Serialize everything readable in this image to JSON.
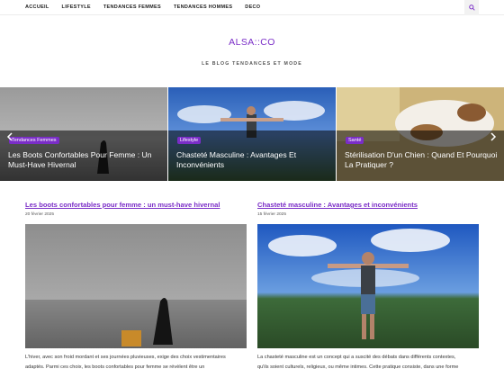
{
  "nav": {
    "items": [
      "ACCUEIL",
      "LIFESTYLE",
      "TENDANCES FEMMES",
      "TENDANCES HOMMES",
      "DECO"
    ],
    "search_icon": "search-icon"
  },
  "header": {
    "title": "ALSA::CO",
    "tagline": "LE BLOG TENDANCES ET MODE"
  },
  "slider": {
    "slides": [
      {
        "category": "Tendances Femmes",
        "title": "Les Boots Confortables Pour Femme : Un Must-Have Hivernal"
      },
      {
        "category": "Lifestyle",
        "title": "Chasteté Masculine : Avantages Et Inconvénients"
      },
      {
        "category": "Santé",
        "title": "Stérilisation D'un Chien : Quand Et Pourquoi La Pratiquer ?"
      }
    ],
    "prev_icon": "chevron-left-icon",
    "next_icon": "chevron-right-icon"
  },
  "articles": [
    {
      "title": "Les boots confortables pour femme : un must-have hivernal",
      "date": "20 février 2025",
      "excerpt_line1": "L'hiver, avec son froid mordant et ses journées pluvieuses, exige des choix vestimentaires",
      "excerpt_line2": "adaptés. Parmi ces choix, les boots confortables pour femme se révèlent être un"
    },
    {
      "title": "Chasteté masculine : Avantages et inconvénients",
      "date": "15 février 2025",
      "excerpt_line1": "La chasteté masculine est un concept qui a suscité des débats dans différents contextes,",
      "excerpt_line2": "qu'ils soient culturels, religieux, ou même intimes. Cette pratique consiste, dans une forme"
    }
  ],
  "colors": {
    "accent": "#7a2dc7"
  }
}
